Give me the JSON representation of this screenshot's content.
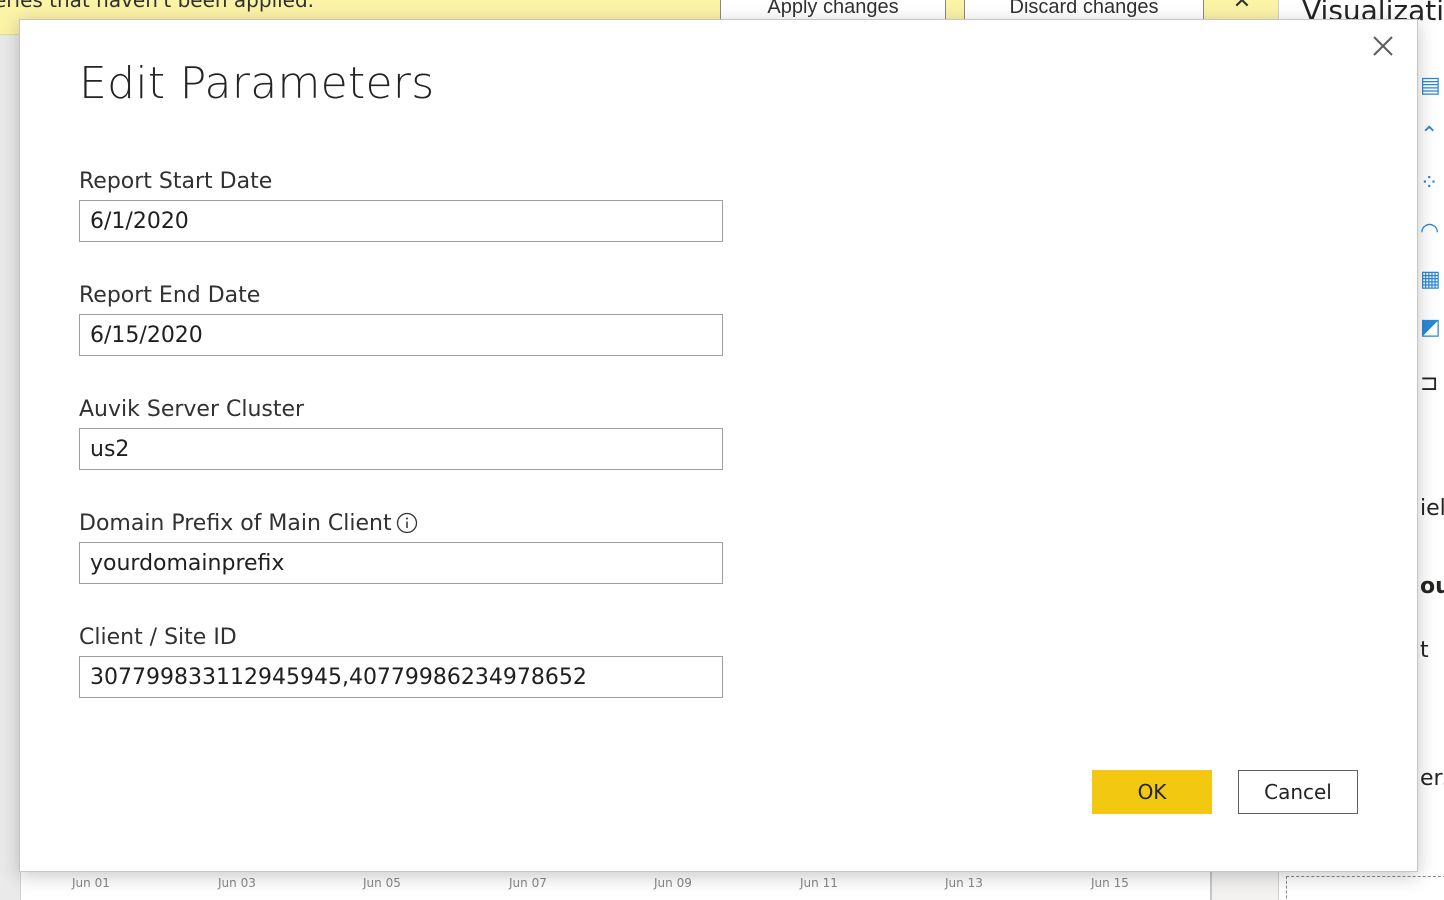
{
  "background": {
    "banner": {
      "message": "eries that haven't been applied.",
      "apply_label": "Apply changes",
      "discard_label": "Discard changes"
    },
    "right_pane": {
      "title": "Visualizations",
      "fragments": [
        "iel",
        "ou",
        "t",
        "ers"
      ]
    },
    "axis_labels": [
      "Jun 01",
      "Jun 03",
      "Jun 05",
      "Jun 07",
      "Jun 09",
      "Jun 11",
      "Jun 13",
      "Jun 15"
    ]
  },
  "dialog": {
    "title": "Edit Parameters",
    "fields": [
      {
        "label": "Report Start Date",
        "value": "6/1/2020"
      },
      {
        "label": "Report End Date",
        "value": "6/15/2020"
      },
      {
        "label": "Auvik Server Cluster",
        "value": "us2"
      },
      {
        "label": "Domain Prefix of Main Client",
        "value": "yourdomainprefix",
        "has_info": true
      },
      {
        "label": "Client / Site ID",
        "value": "307799833112945945,40779986234978652"
      }
    ],
    "ok_label": "OK",
    "cancel_label": "Cancel"
  },
  "colors": {
    "accent": "#f2c811",
    "banner": "#fbf3a6",
    "text": "#252423"
  }
}
